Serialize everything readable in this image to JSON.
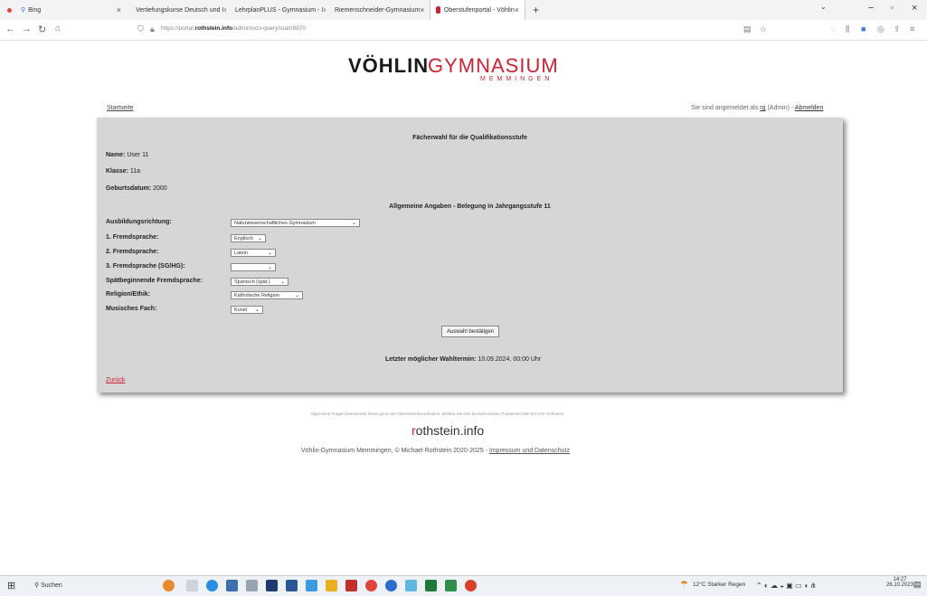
{
  "browser": {
    "tabs": [
      {
        "title": "Bing",
        "color": "#e0463e"
      },
      {
        "title": "Vertiefungskurse Deutsch und I",
        "color": "#4a86c8"
      },
      {
        "title": "LehrplanPLUS - Gymnasium - I",
        "color": "#2e8b3e"
      },
      {
        "title": "Riemenschneider-Gymnasium",
        "color": "#c89a20"
      },
      {
        "title": "Oberstufenportal - Vöhlin",
        "color": "#cc2233"
      }
    ],
    "url_prefix": "https://portal.",
    "url_domain": "rothstein.info",
    "url_path": "/admin/oco-query/start/9870"
  },
  "header": {
    "logo_part1": "VÖHLIN",
    "logo_part2": "GYMNASIUM",
    "logo_part3": "MEMMINGEN",
    "start_link": "Startseite",
    "logged_in_prefix": "Sie sind angemeldet als ",
    "logged_in_user": "rg",
    "logged_in_role": " (Admin) - ",
    "logout_link": "Abmelden"
  },
  "panel": {
    "title": "Fächerwahl für die Qualifikationsstufe",
    "name_label": "Name:",
    "name_value": "User 11",
    "class_label": "Klasse:",
    "class_value": "11a",
    "birth_label": "Geburtsdatum:",
    "birth_value": "2000",
    "section_title": "Allgemeine Angaben - Belegung in Jahrgangsstufe 11",
    "fields": [
      {
        "label": "Ausbildungsrichtung:",
        "value": "Naturwissenschaftliches Gymnasium"
      },
      {
        "label": "1. Fremdsprache:",
        "value": "Englisch"
      },
      {
        "label": "2. Fremdsprache:",
        "value": "Latein"
      },
      {
        "label": "3. Fremdsprache (SG/HG):",
        "value": ""
      },
      {
        "label": "Spätbeginnende Fremdsprache:",
        "value": "Spanisch (spät.)"
      },
      {
        "label": "Religion/Ethik:",
        "value": "Katholische Religion"
      },
      {
        "label": "Musisches Fach:",
        "value": "Kunst"
      }
    ],
    "confirm_button": "Auswahl bestätigen",
    "deadline_label": "Letzter möglicher Wahltermin:",
    "deadline_value": "10.09.2024, 00:00 Uhr",
    "back_link": "Zurück"
  },
  "footer": {
    "note": "Allgemeine Fragen beantwortet Ihnen gerne die Oberstufenkoordination. Melden Sie sich bei technischen Problemen bitte bei Herr Rothstein",
    "brand_r": "r",
    "brand_rest": "othstein.info",
    "copyright": "Vöhlin-Gymnasium Memmingen, © Michael Rothstein 2020-2025 - ",
    "imprint_link": "Impressum und Datenschutz"
  },
  "taskbar": {
    "search_placeholder": "Suchen",
    "weather": "12°C Starker Regen",
    "time": "14:27",
    "date": "26.10.2023"
  }
}
